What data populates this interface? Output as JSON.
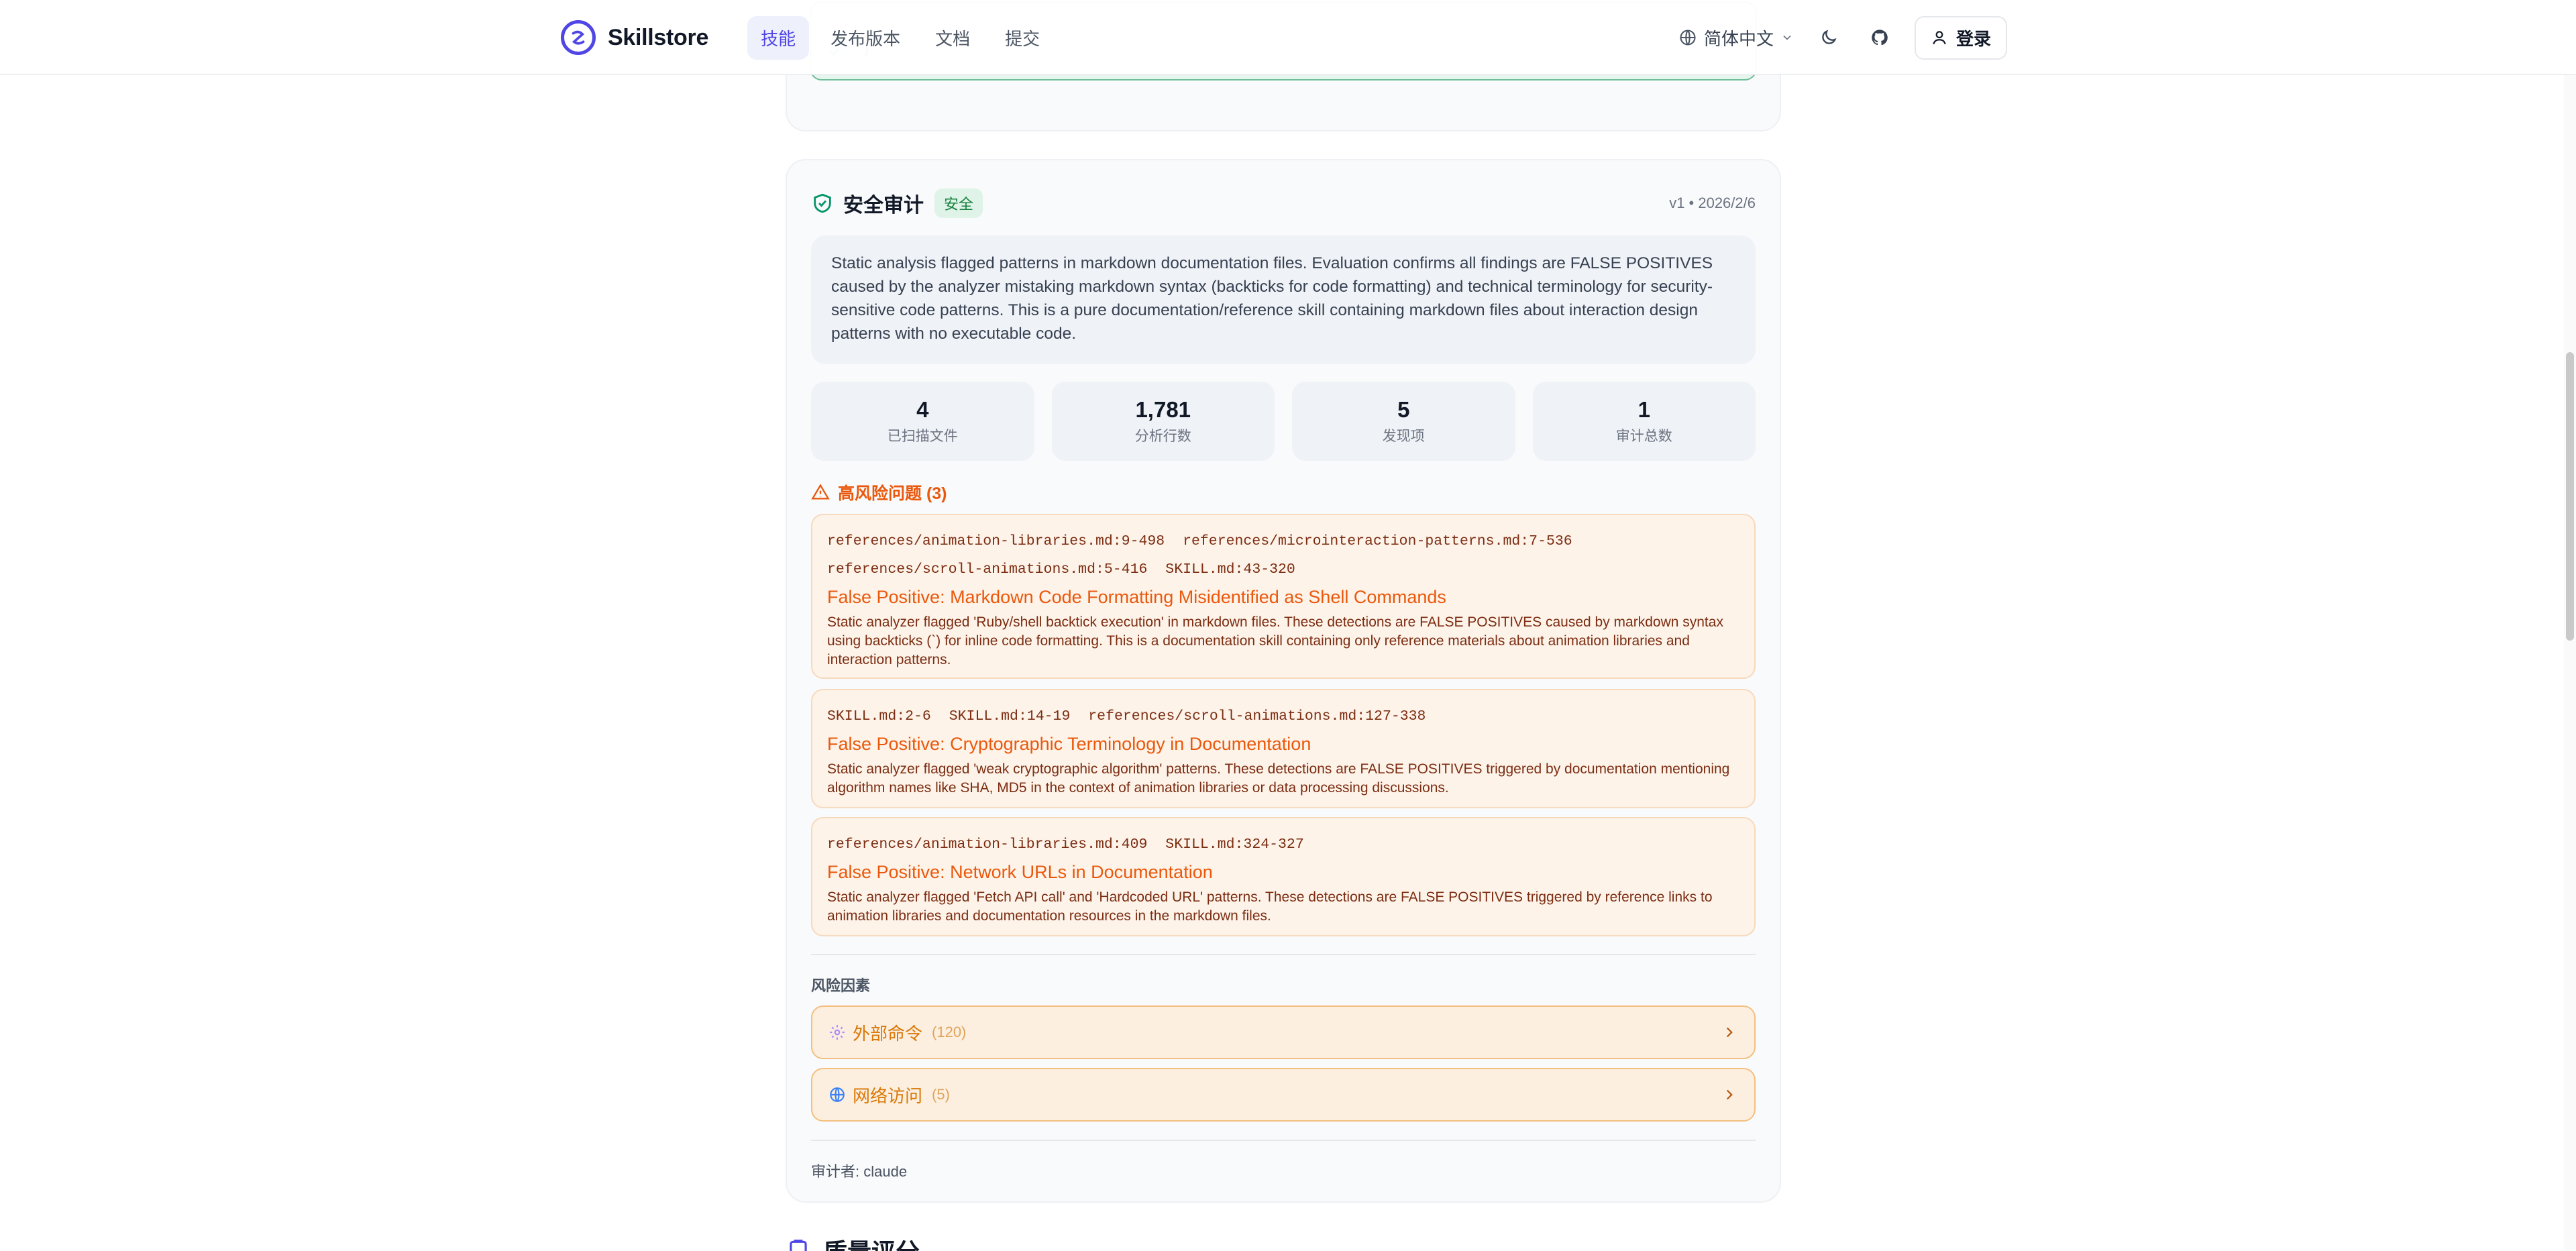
{
  "header": {
    "brand": "Skillstore",
    "nav": [
      {
        "label": "技能",
        "active": true
      },
      {
        "label": "发布版本",
        "active": false
      },
      {
        "label": "文档",
        "active": false
      },
      {
        "label": "提交",
        "active": false
      }
    ],
    "language": "简体中文",
    "login_label": "登录",
    "accent_color": "#4f46e5"
  },
  "previous_card": {
    "code_tail": "}"
  },
  "audit": {
    "title": "安全审计",
    "status_badge": "安全",
    "meta": "v1 • 2026/2/6",
    "summary": "Static analysis flagged patterns in markdown documentation files. Evaluation confirms all findings are FALSE POSITIVES caused by the analyzer mistaking markdown syntax (backticks for code formatting) and technical terminology for security-sensitive code patterns. This is a pure documentation/reference skill containing markdown files about interaction design patterns with no executable code.",
    "stats": [
      {
        "value": "4",
        "label": "已扫描文件"
      },
      {
        "value": "1,781",
        "label": "分析行数"
      },
      {
        "value": "5",
        "label": "发现项"
      },
      {
        "value": "1",
        "label": "审计总数"
      }
    ],
    "high_risk_heading": "高风险问题 (3)",
    "issues": [
      {
        "files": [
          "references/animation-libraries.md:9-498",
          "references/microinteraction-patterns.md:7-536",
          "references/scroll-animations.md:5-416",
          "SKILL.md:43-320"
        ],
        "title": "False Positive: Markdown Code Formatting Misidentified as Shell Commands",
        "description": "Static analyzer flagged 'Ruby/shell backtick execution' in markdown files. These detections are FALSE POSITIVES caused by markdown syntax using backticks (`) for inline code formatting. This is a documentation skill containing only reference materials about animation libraries and interaction patterns."
      },
      {
        "files": [
          "SKILL.md:2-6",
          "SKILL.md:14-19",
          "references/scroll-animations.md:127-338"
        ],
        "title": "False Positive: Cryptographic Terminology in Documentation",
        "description": "Static analyzer flagged 'weak cryptographic algorithm' patterns. These detections are FALSE POSITIVES triggered by documentation mentioning algorithm names like SHA, MD5 in the context of animation libraries or data processing discussions."
      },
      {
        "files": [
          "references/animation-libraries.md:409",
          "SKILL.md:324-327"
        ],
        "title": "False Positive: Network URLs in Documentation",
        "description": "Static analyzer flagged 'Fetch API call' and 'Hardcoded URL' patterns. These detections are FALSE POSITIVES triggered by reference links to animation libraries and documentation resources in the markdown files."
      }
    ],
    "risk_factors_label": "风险因素",
    "risk_factors": [
      {
        "icon": "gear-icon",
        "label": "外部命令",
        "count": "(120)"
      },
      {
        "icon": "globe-icon",
        "label": "网络访问",
        "count": "(5)"
      }
    ],
    "auditor": "审计者: claude",
    "colors": {
      "safe": "#059669",
      "risk": "#ea580c",
      "factor": "#d97706"
    }
  },
  "next_section": {
    "title": "质量评分"
  }
}
